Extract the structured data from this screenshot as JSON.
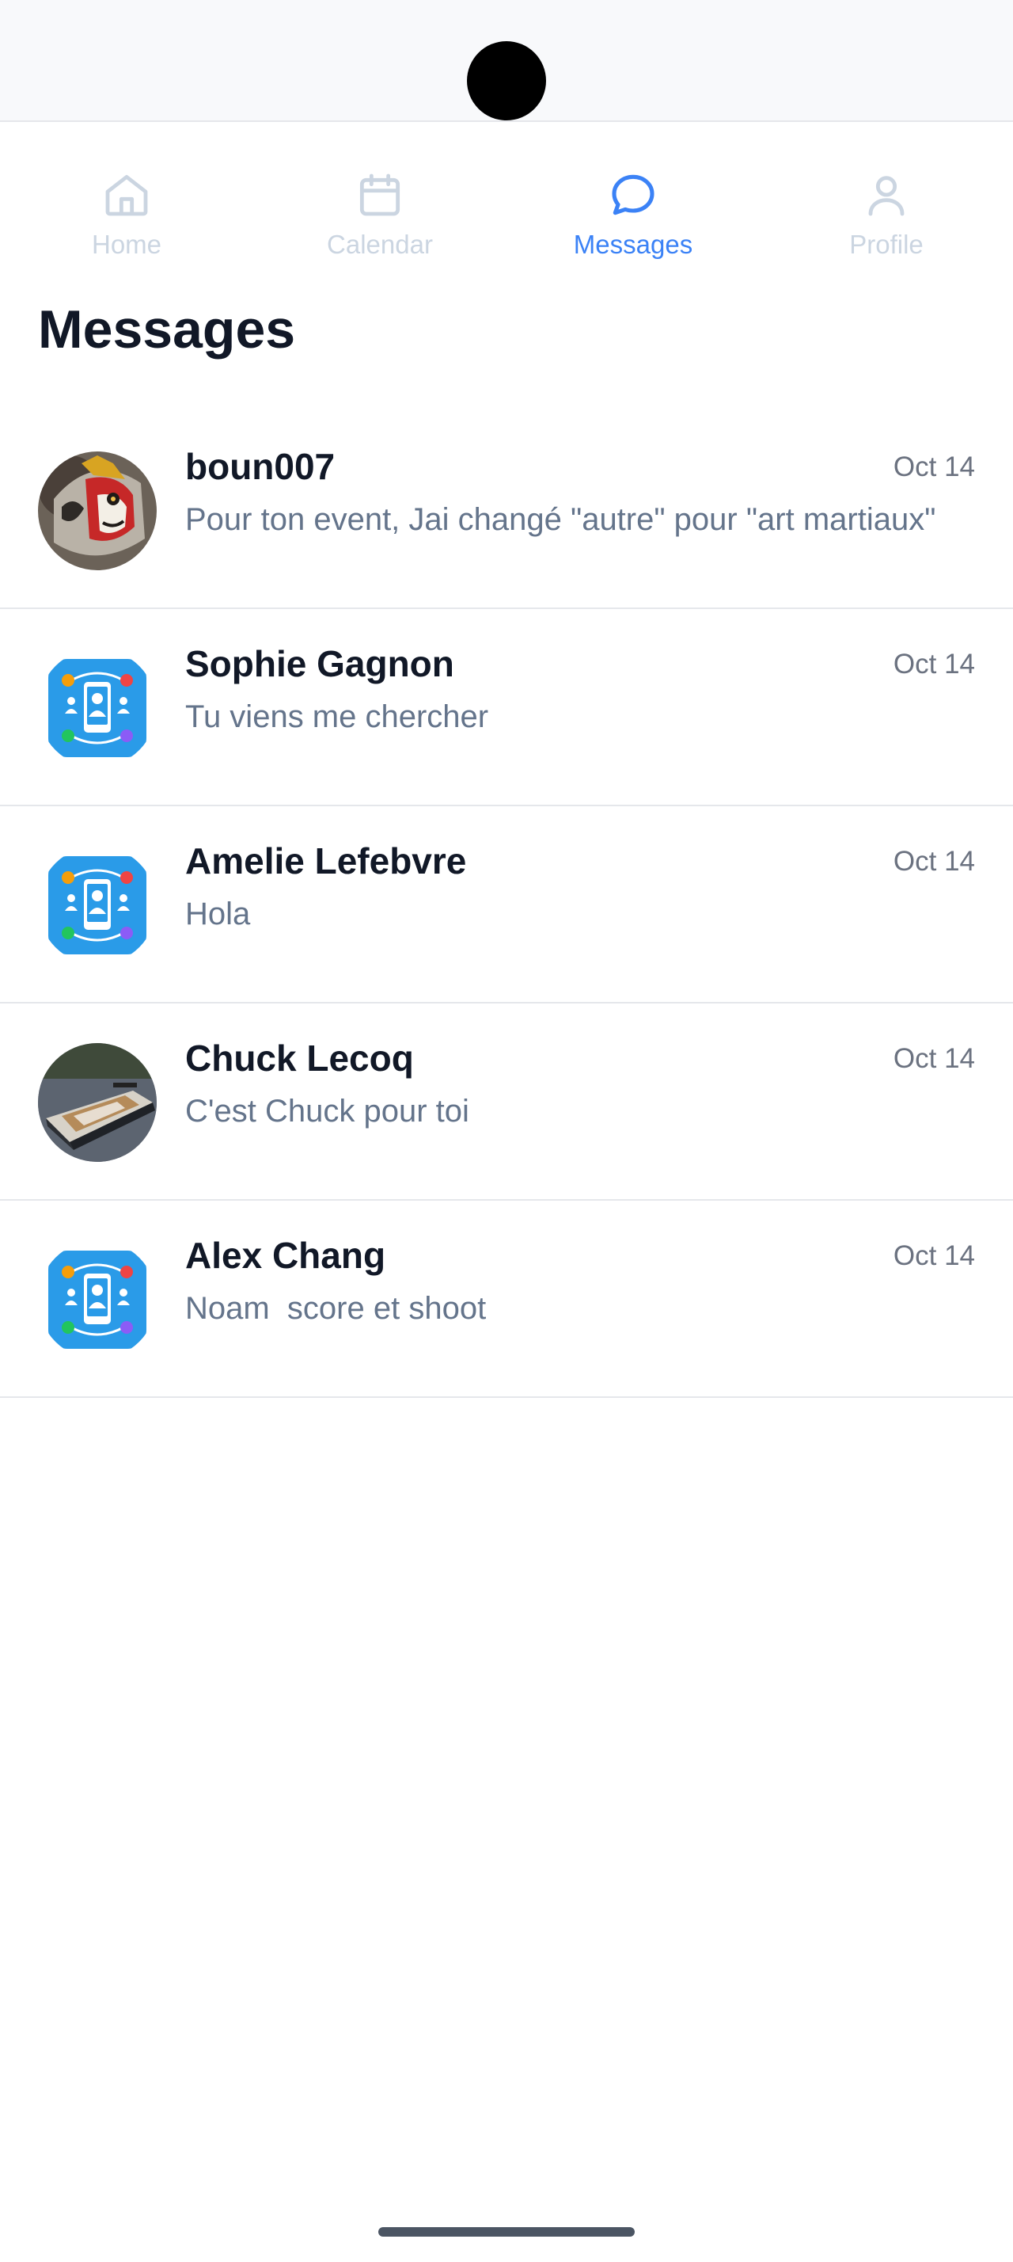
{
  "tabs": [
    {
      "label": "Home",
      "icon": "home-icon",
      "active": false
    },
    {
      "label": "Calendar",
      "icon": "calendar-icon",
      "active": false
    },
    {
      "label": "Messages",
      "icon": "chat-bubble-icon",
      "active": true
    },
    {
      "label": "Profile",
      "icon": "user-icon",
      "active": false
    }
  ],
  "page": {
    "title": "Messages"
  },
  "conversations": [
    {
      "name": "boun007",
      "date": "Oct 14",
      "preview": "Pour ton event, Jai changé \"autre\" pour \"art martiaux\"",
      "avatar": "mask-photo"
    },
    {
      "name": "Sophie Gagnon",
      "date": "Oct 14",
      "preview": "Tu viens me chercher",
      "avatar": "app-logo"
    },
    {
      "name": "Amelie Lefebvre",
      "date": "Oct 14",
      "preview": "Hola",
      "avatar": "app-logo"
    },
    {
      "name": "Chuck Lecoq",
      "date": "Oct 14",
      "preview": "C'est Chuck pour toi",
      "avatar": "boat-photo"
    },
    {
      "name": "Alex Chang",
      "date": "Oct 14",
      "preview": "Noam  score et shoot",
      "avatar": "app-logo"
    }
  ],
  "colors": {
    "accent": "#3b82f6",
    "inactive": "#cbd5e1",
    "title": "#111827",
    "muted": "#64748b"
  }
}
